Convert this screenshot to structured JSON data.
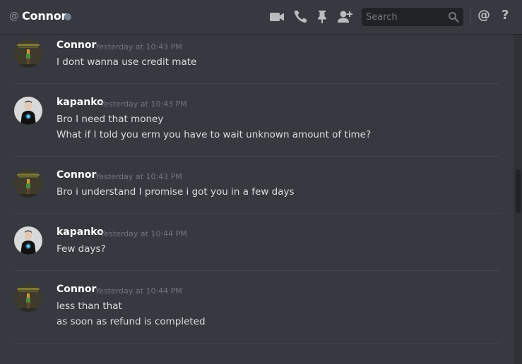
{
  "header": {
    "at_symbol": "@",
    "title": "Connor",
    "status_color": "#747f8d",
    "icons": [
      "video-camera-icon",
      "phone-icon",
      "pin-icon",
      "add-user-icon",
      "search-icon",
      "mention-icon",
      "help-icon"
    ],
    "search_placeholder": "Search",
    "mention_symbol": "@",
    "help_symbol": "?"
  },
  "messages": [
    {
      "author": "Connor",
      "timestamp": "Yesterday at 10:43 PM",
      "lines": [
        "I dont wanna use credit mate"
      ],
      "avatar": "connor-avatar"
    },
    {
      "author": "kapanko",
      "timestamp": "Yesterday at 10:43 PM",
      "lines": [
        "Bro I need that money",
        "What if I told you erm you have to wait unknown amount of time?"
      ],
      "avatar": "kapanko-avatar"
    },
    {
      "author": "Connor",
      "timestamp": "Yesterday at 10:43 PM",
      "lines": [
        "Bro i understand I promise i got you in a few days"
      ],
      "avatar": "connor-avatar"
    },
    {
      "author": "kapanko",
      "timestamp": "Yesterday at 10:44 PM",
      "lines": [
        "Few days?"
      ],
      "avatar": "kapanko-avatar"
    },
    {
      "author": "Connor",
      "timestamp": "Yesterday at 10:44 PM",
      "lines": [
        "less than that",
        "as soon as refund is completed"
      ],
      "avatar": "connor-avatar"
    }
  ],
  "colors": {
    "background": "#36393f",
    "username": "#ffffff",
    "message_text": "#dcddde",
    "timestamp": "#72767d",
    "icon": "#b9bbbe"
  }
}
